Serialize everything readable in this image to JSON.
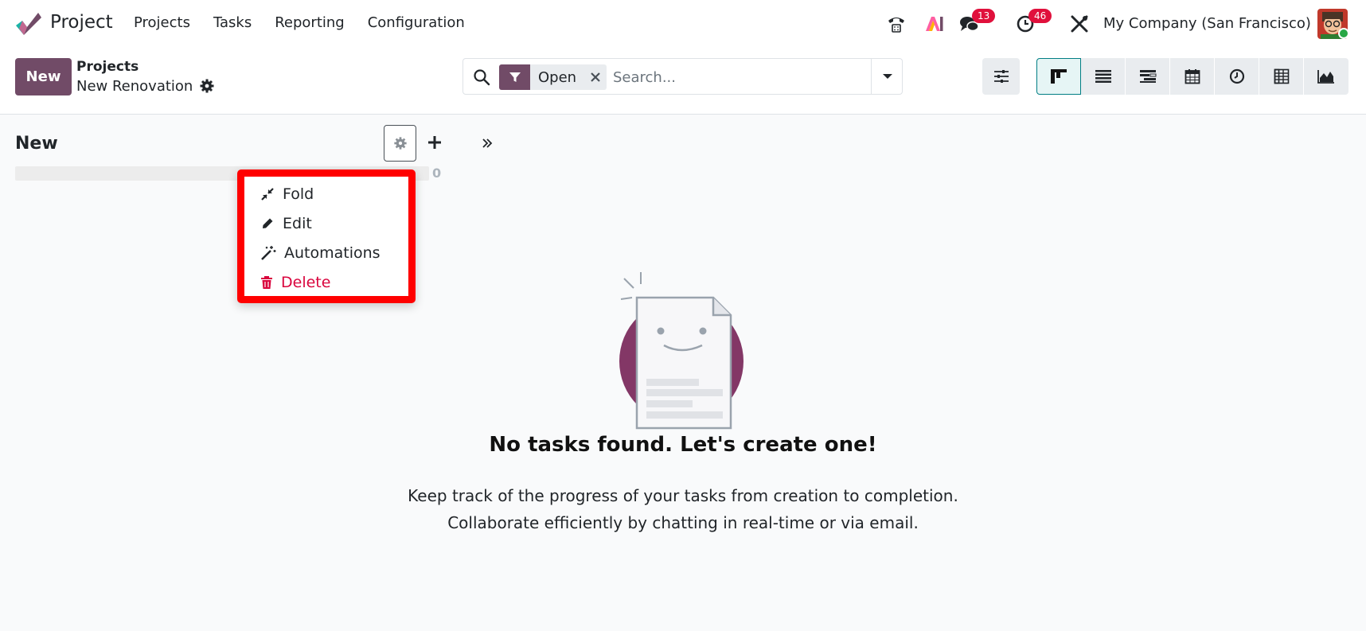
{
  "navbar": {
    "app_name": "Project",
    "menu": [
      "Projects",
      "Tasks",
      "Reporting",
      "Configuration"
    ],
    "messages_count": "13",
    "activities_count": "46",
    "company": "My Company (San Francisco)",
    "brand_color": "#714b67"
  },
  "control_panel": {
    "new_label": "New",
    "breadcrumb_parent": "Projects",
    "breadcrumb_current": "New Renovation",
    "search": {
      "facet": "Open",
      "placeholder": "Search..."
    },
    "views": [
      "kanban-icon",
      "list-icon",
      "gantt-icon",
      "calendar-icon",
      "activity-icon",
      "pivot-icon",
      "graph-icon"
    ]
  },
  "kanban": {
    "column_title": "New",
    "column_count": "0",
    "menu": {
      "fold": "Fold",
      "edit": "Edit",
      "automations": "Automations",
      "delete": "Delete"
    }
  },
  "empty_state": {
    "title": "No tasks found. Let's create one!",
    "line1": "Keep track of the progress of your tasks from creation to completion.",
    "line2": "Collaborate efficiently by chatting in real-time or via email."
  }
}
